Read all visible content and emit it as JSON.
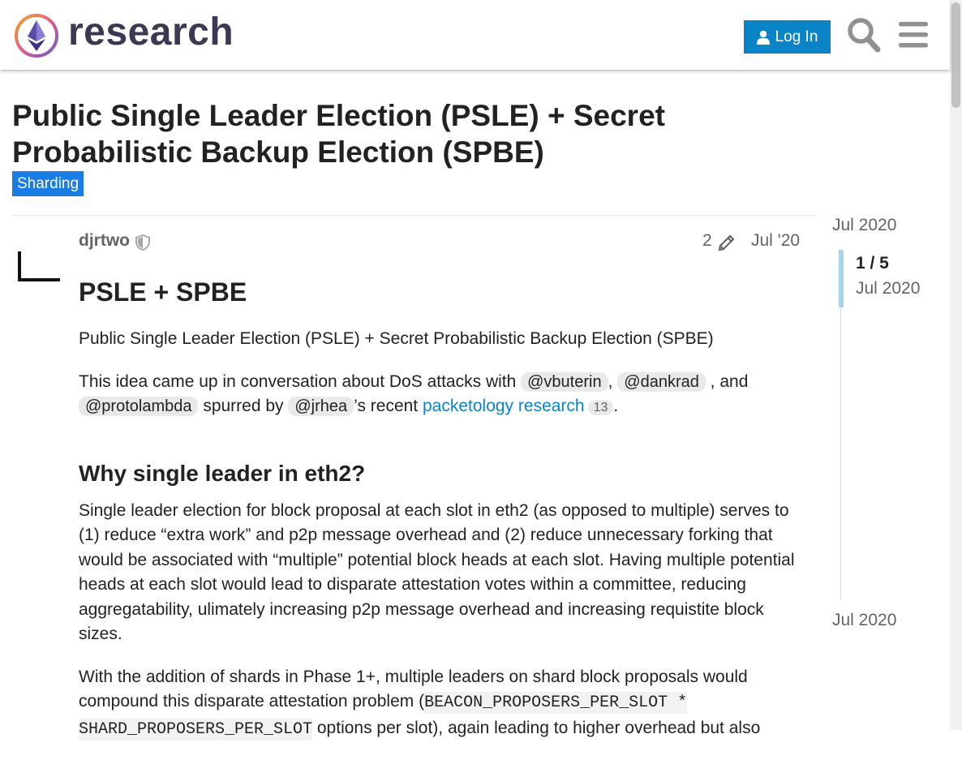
{
  "header": {
    "brand": "research",
    "login_label": "Log In"
  },
  "icons": {
    "logo": "ethereum-research-logo",
    "login": "user-icon",
    "search": "search-icon",
    "menu": "hamburger-menu-icon",
    "staff": "shield-icon",
    "edits": "pencil-icon"
  },
  "colors": {
    "accent": "#0a84c6",
    "category": "#1a7de4",
    "muted_text": "#646464"
  },
  "topic": {
    "title": "Public Single Leader Election (PSLE) + Secret Probabilistic Backup Election (SPBE)",
    "category": "Sharding"
  },
  "post": {
    "username": "djrtwo",
    "edit_count": "2",
    "date": "Jul '20",
    "heading": "PSLE + SPBE",
    "subtitle": "Public Single Leader Election (PSLE) + Secret Probabilistic Backup Election (SPBE)",
    "intro": {
      "t1": "This idea came up in conversation about DoS attacks with ",
      "m1": "@vbuterin",
      "t2": ", ",
      "m2": "@dankrad",
      "t3": " , and ",
      "m3": "@protolambda",
      "t4": " spurred by ",
      "m4": "@jrhea",
      "t5": "’s recent ",
      "link": "packetology research",
      "link_count": "13",
      "t6": "."
    },
    "section_heading": "Why single leader in eth2?",
    "paragraph1": "Single leader election for block proposal at each slot in eth2 (as opposed to multiple) serves to (1) reduce “extra work” and p2p message overhead and (2) reduce unnecessary forking that would be associated with “multiple” potential block heads at each slot. Having multiple potential heads at each slot would lead to disparate attestation votes within a committee, reducing aggregatability, ulimately increasing p2p message overhead and increasing requistite block sizes.",
    "paragraph2": {
      "t1": "With the addition of shards in Phase 1+, multiple leaders on shard block proposals would compound this disparate attestation problem (",
      "code": "BEACON_PROPOSERS_PER_SLOT * SHARD_PROPOSERS_PER_SLOT",
      "t2": " options per slot), again leading to higher overhead but also"
    }
  },
  "timeline": {
    "start_date": "Jul 2020",
    "position": "1 / 5",
    "position_date": "Jul 2020",
    "end_date": "Jul 2020"
  }
}
